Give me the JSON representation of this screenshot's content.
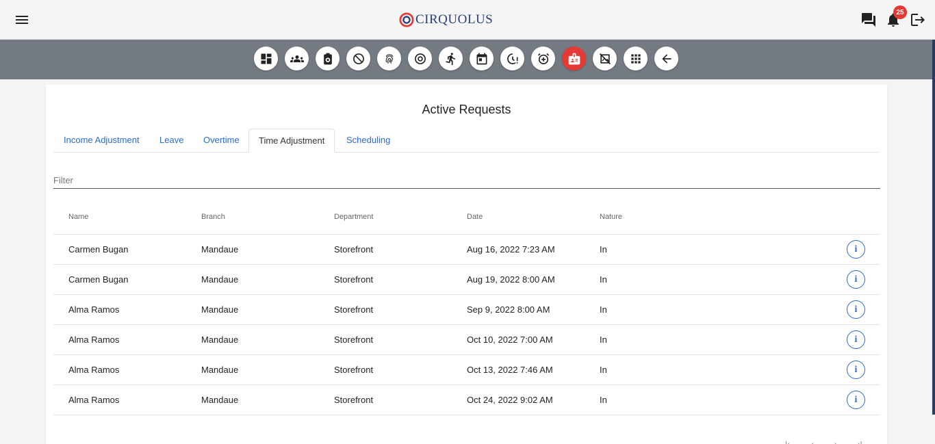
{
  "app": {
    "logo_text": "CIRQUOLUS",
    "notification_count": "25"
  },
  "toolbar": {
    "buttons": [
      {
        "icon": "dashboard-icon"
      },
      {
        "icon": "people-icon"
      },
      {
        "icon": "payroll-icon"
      },
      {
        "icon": "timer-off-icon"
      },
      {
        "icon": "fingerprint-icon"
      },
      {
        "icon": "at-target-icon"
      },
      {
        "icon": "running-person-icon"
      },
      {
        "icon": "calendar-icon"
      },
      {
        "icon": "alert-clock-icon"
      },
      {
        "icon": "add-alarm-icon"
      },
      {
        "icon": "id-badge-icon",
        "active": true
      },
      {
        "icon": "image-off-icon"
      },
      {
        "icon": "apps-grid-icon"
      },
      {
        "icon": "arrow-back-icon"
      }
    ],
    "active_color": "#e53935"
  },
  "page": {
    "title": "Active Requests",
    "tabs": [
      {
        "label": "Income Adjustment"
      },
      {
        "label": "Leave"
      },
      {
        "label": "Overtime"
      },
      {
        "label": "Time Adjustment",
        "selected": true
      },
      {
        "label": "Scheduling"
      }
    ],
    "filter_placeholder": "Filter"
  },
  "table": {
    "headers": [
      "Name",
      "Branch",
      "Department",
      "Date",
      "Nature"
    ],
    "rows": [
      {
        "name": "Carmen Bugan",
        "branch": "Mandaue",
        "department": "Storefront",
        "date": "Aug 16, 2022 7:23 AM",
        "nature": "In"
      },
      {
        "name": "Carmen Bugan",
        "branch": "Mandaue",
        "department": "Storefront",
        "date": "Aug 19, 2022 8:00 AM",
        "nature": "In"
      },
      {
        "name": "Alma Ramos",
        "branch": "Mandaue",
        "department": "Storefront",
        "date": "Sep 9, 2022 8:00 AM",
        "nature": "In"
      },
      {
        "name": "Alma Ramos",
        "branch": "Mandaue",
        "department": "Storefront",
        "date": "Oct 10, 2022 7:00 AM",
        "nature": "In"
      },
      {
        "name": "Alma Ramos",
        "branch": "Mandaue",
        "department": "Storefront",
        "date": "Oct 13, 2022 7:46 AM",
        "nature": "In"
      },
      {
        "name": "Alma Ramos",
        "branch": "Mandaue",
        "department": "Storefront",
        "date": "Oct 24, 2022 9:02 AM",
        "nature": "In"
      }
    ],
    "info_label": "i"
  },
  "colors": {
    "link": "#2a6bcc",
    "toolbar_bg": "#737a82",
    "badge": "#e53935"
  }
}
